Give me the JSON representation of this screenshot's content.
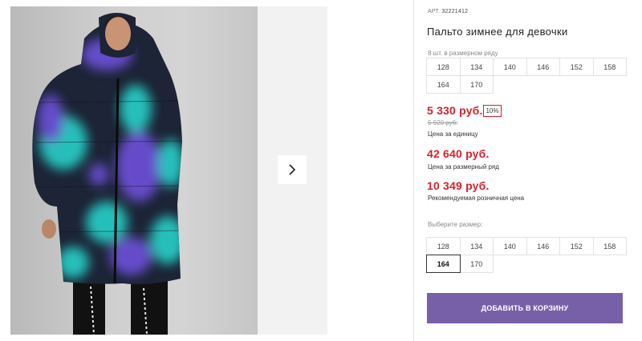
{
  "product": {
    "article_label": "АРТ.",
    "article_number": "32221412",
    "title": "Пальто зимнее для девочки"
  },
  "row_sizes": {
    "hint": "8 шт. в размерном ряду",
    "items": [
      "128",
      "134",
      "140",
      "146",
      "152",
      "158",
      "164",
      "170"
    ]
  },
  "pricing": {
    "unit_price": "5 330 руб.",
    "discount_badge": "10%",
    "old_price": "5 920 руб.",
    "unit_caption": "Цена за единицу",
    "row_price": "42 640 руб.",
    "row_caption": "Цена за размерный ряд",
    "retail_price": "10 349 руб.",
    "retail_caption": "Рекомендуемая розничная цена"
  },
  "size_select": {
    "label": "Выберите размер:",
    "items": [
      "128",
      "134",
      "140",
      "146",
      "152",
      "158",
      "164",
      "170"
    ],
    "selected": "164"
  },
  "cart": {
    "add_label": "ДОБАВИТЬ В КОРЗИНУ"
  },
  "gallery": {
    "next_icon": "chevron-right-icon"
  },
  "colors": {
    "accent_price": "#d6202a",
    "button_bg": "#7860a8",
    "coat_navy": "#1c2436",
    "coat_purple": "#6b4fd3",
    "coat_teal": "#27c9c2"
  }
}
